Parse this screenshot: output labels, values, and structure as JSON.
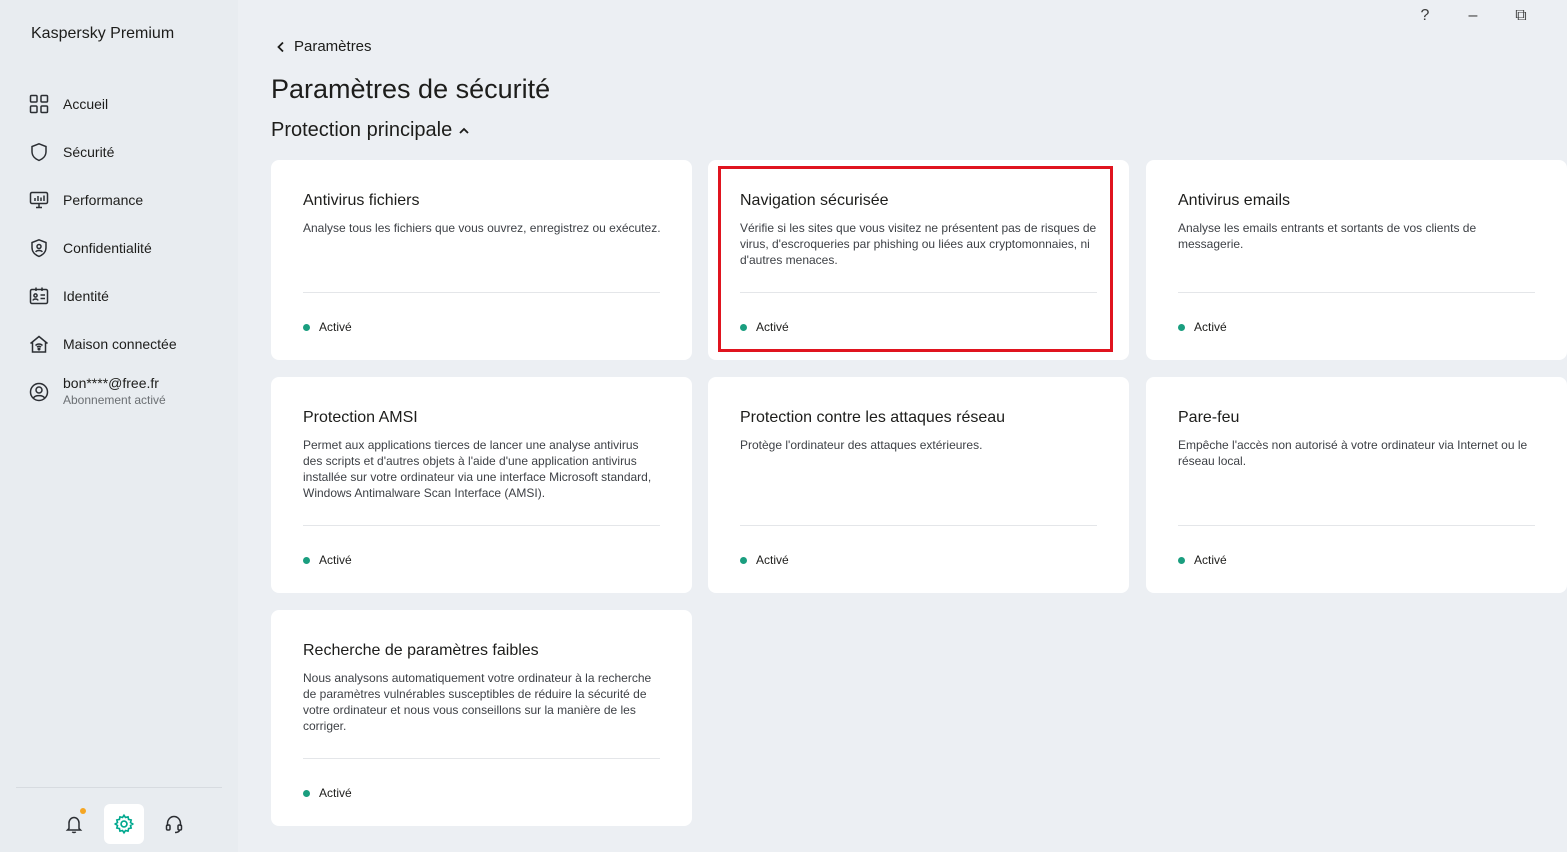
{
  "app": {
    "title": "Kaspersky Premium"
  },
  "window": {
    "help": "?",
    "minimize": "–",
    "restore": "⧉"
  },
  "sidebar": {
    "items": [
      {
        "label": "Accueil",
        "icon": "home-grid-icon"
      },
      {
        "label": "Sécurité",
        "icon": "shield-icon"
      },
      {
        "label": "Performance",
        "icon": "monitor-icon"
      },
      {
        "label": "Confidentialité",
        "icon": "privacy-shield-icon"
      },
      {
        "label": "Identité",
        "icon": "id-card-icon"
      },
      {
        "label": "Maison connectée",
        "icon": "smart-home-icon"
      }
    ],
    "account": {
      "email": "bon****@free.fr",
      "subscription": "Abonnement activé"
    }
  },
  "main": {
    "back_label": "Paramètres",
    "title": "Paramètres de sécurité",
    "section_title": "Protection principale",
    "cards": [
      {
        "title": "Antivirus fichiers",
        "description": "Analyse tous les fichiers que vous ouvrez, enregistrez ou exécutez.",
        "status": "Activé"
      },
      {
        "title": "Navigation sécurisée",
        "description": "Vérifie si les sites que vous visitez ne présentent pas de risques de virus, d'escroqueries par phishing ou liées aux cryptomonnaies, ni d'autres menaces.",
        "status": "Activé"
      },
      {
        "title": "Antivirus emails",
        "description": "Analyse les emails entrants et sortants de vos clients de messagerie.",
        "status": "Activé"
      },
      {
        "title": "Protection AMSI",
        "description": "Permet aux applications tierces de lancer une analyse antivirus des scripts et d'autres objets à l'aide d'une application antivirus installée sur votre ordinateur via une interface Microsoft standard, Windows Antimalware Scan Interface (AMSI).",
        "status": "Activé"
      },
      {
        "title": "Protection contre les attaques réseau",
        "description": "Protège l'ordinateur des attaques extérieures.",
        "status": "Activé"
      },
      {
        "title": "Pare-feu",
        "description": "Empêche l'accès non autorisé à votre ordinateur via Internet ou le réseau local.",
        "status": "Activé"
      },
      {
        "title": "Recherche de paramètres faibles",
        "description": "Nous analysons automatiquement votre ordinateur à la recherche de paramètres vulnérables susceptibles de réduire la sécurité de votre ordinateur et nous vous conseillons sur la manière de les corriger.",
        "status": "Activé"
      }
    ]
  },
  "colors": {
    "status_active": "#1a9e7f",
    "accent_green": "#00a88e",
    "highlight_red": "#e0141f",
    "notification_dot": "#f5a623"
  }
}
